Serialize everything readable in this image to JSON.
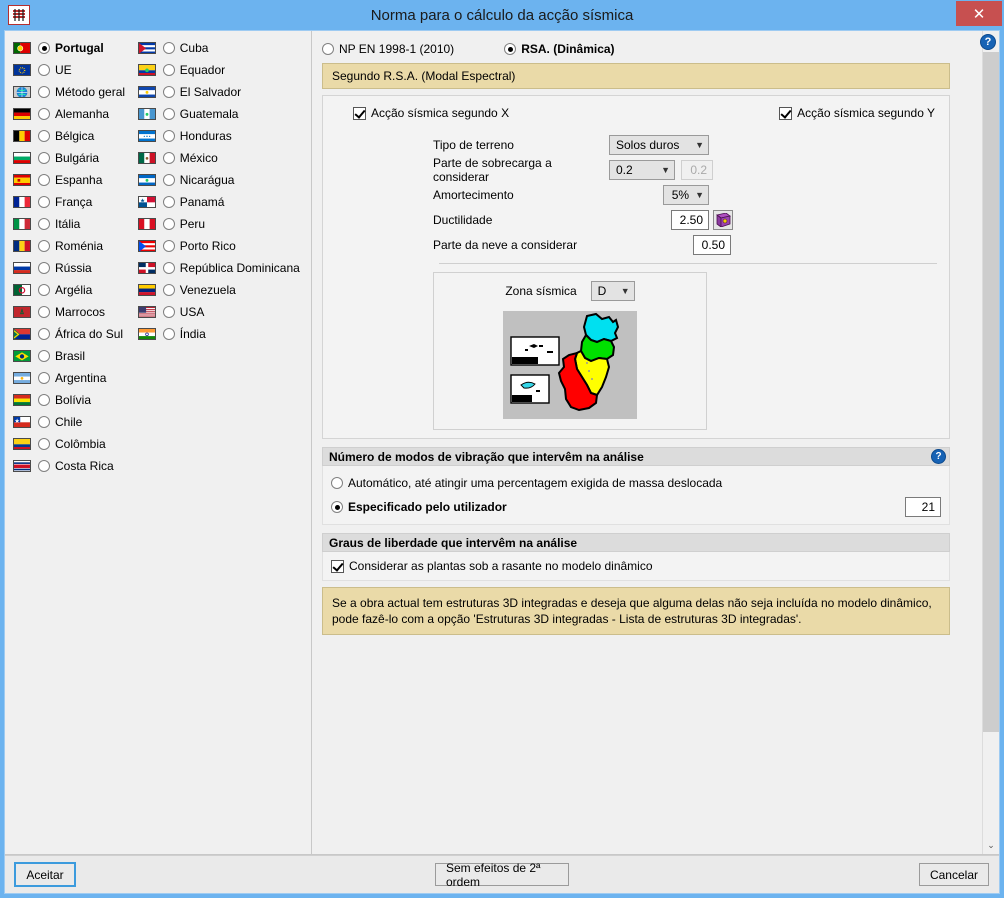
{
  "window": {
    "title": "Norma para o cálculo da acção sísmica",
    "app_icon": "app-icon",
    "close_label": "✕"
  },
  "countries": {
    "column1": [
      {
        "label": "Portugal",
        "flag": "portugal",
        "selected": true
      },
      {
        "label": "UE",
        "flag": "eu",
        "selected": false
      },
      {
        "label": "Método geral",
        "flag": "globe",
        "selected": false
      },
      {
        "label": "Alemanha",
        "flag": "germany",
        "selected": false
      },
      {
        "label": "Bélgica",
        "flag": "belgium",
        "selected": false
      },
      {
        "label": "Bulgária",
        "flag": "bulgaria",
        "selected": false
      },
      {
        "label": "Espanha",
        "flag": "spain",
        "selected": false
      },
      {
        "label": "França",
        "flag": "france",
        "selected": false
      },
      {
        "label": "Itália",
        "flag": "italy",
        "selected": false
      },
      {
        "label": "Roménia",
        "flag": "romania",
        "selected": false
      },
      {
        "label": "Rússia",
        "flag": "russia",
        "selected": false
      },
      {
        "label": "Argélia",
        "flag": "algeria",
        "selected": false
      },
      {
        "label": "Marrocos",
        "flag": "morocco",
        "selected": false
      },
      {
        "label": "África do Sul",
        "flag": "south-africa",
        "selected": false
      },
      {
        "label": "Brasil",
        "flag": "brazil",
        "selected": false
      },
      {
        "label": "Argentina",
        "flag": "argentina",
        "selected": false
      },
      {
        "label": "Bolívia",
        "flag": "bolivia",
        "selected": false
      },
      {
        "label": "Chile",
        "flag": "chile",
        "selected": false
      },
      {
        "label": "Colômbia",
        "flag": "colombia",
        "selected": false
      },
      {
        "label": "Costa Rica",
        "flag": "costa-rica",
        "selected": false
      }
    ],
    "column2": [
      {
        "label": "Cuba",
        "flag": "cuba",
        "selected": false
      },
      {
        "label": "Equador",
        "flag": "ecuador",
        "selected": false
      },
      {
        "label": "El Salvador",
        "flag": "el-salvador",
        "selected": false
      },
      {
        "label": "Guatemala",
        "flag": "guatemala",
        "selected": false
      },
      {
        "label": "Honduras",
        "flag": "honduras",
        "selected": false
      },
      {
        "label": "México",
        "flag": "mexico",
        "selected": false
      },
      {
        "label": "Nicarágua",
        "flag": "nicaragua",
        "selected": false
      },
      {
        "label": "Panamá",
        "flag": "panama",
        "selected": false
      },
      {
        "label": "Peru",
        "flag": "peru",
        "selected": false
      },
      {
        "label": "Porto Rico",
        "flag": "puerto-rico",
        "selected": false
      },
      {
        "label": "República Dominicana",
        "flag": "dominican-republic",
        "selected": false
      },
      {
        "label": "Venezuela",
        "flag": "venezuela",
        "selected": false
      },
      {
        "label": "USA",
        "flag": "usa",
        "selected": false
      },
      {
        "label": "Índia",
        "flag": "india",
        "selected": false
      }
    ]
  },
  "norms": {
    "option_np": "NP EN 1998-1 (2010)",
    "option_rsa": "RSA. (Dinâmica)",
    "selected": "rsa",
    "banner": "Segundo R.S.A. (Modal Espectral)"
  },
  "seismic_axes": {
    "x_label": "Acção sísmica segundo X",
    "x_checked": true,
    "y_label": "Acção sísmica segundo Y",
    "y_checked": true
  },
  "params": {
    "terreno_label": "Tipo de terreno",
    "terreno_value": "Solos duros",
    "sobrecarga_label": "Parte de sobrecarga a considerar",
    "sobrecarga_value": "0.2",
    "sobrecarga_readonly": "0.2",
    "amortecimento_label": "Amortecimento",
    "amortecimento_value": "5%",
    "ductilidade_label": "Ductilidade",
    "ductilidade_value": "2.50",
    "neve_label": "Parte da neve a considerar",
    "neve_value": "0.50",
    "book_icon": "book-icon"
  },
  "zone": {
    "label": "Zona sísmica",
    "value": "D",
    "map_name": "portugal-seismic-zone-map",
    "map_colors": {
      "zone_a": "#ff0000",
      "zone_b": "#ffff00",
      "zone_c": "#00e000",
      "zone_d": "#00e0f0",
      "background": "#c0c0c0"
    }
  },
  "modes": {
    "header": "Número de modos de vibração que intervêm na análise",
    "auto_label": "Automático, até atingir uma percentagem exigida de massa deslocada",
    "auto_selected": false,
    "user_label": "Especificado pelo utilizador",
    "user_selected": true,
    "user_value": "21",
    "help_icon": "?"
  },
  "dof": {
    "header": "Graus de liberdade que intervêm na análise",
    "checkbox_label": "Considerar as plantas sob a rasante no modelo dinâmico",
    "checkbox_checked": true,
    "note": "Se a obra actual tem estruturas 3D integradas e deseja que alguma delas não seja incluída no modelo dinâmico, pode fazê-lo com a opção 'Estruturas 3D integradas - Lista de estruturas 3D integradas'."
  },
  "scrollbar": {
    "up_arrow": "⌃",
    "down_arrow": "⌄"
  },
  "footer": {
    "accept": "Aceitar",
    "middle": "Sem efeitos de 2ª ordem",
    "cancel": "Cancelar"
  },
  "colors": {
    "titlebar": "#6cb3ef",
    "banner": "#eadaa8",
    "close": "#c75050",
    "accent": "#1763b5"
  }
}
